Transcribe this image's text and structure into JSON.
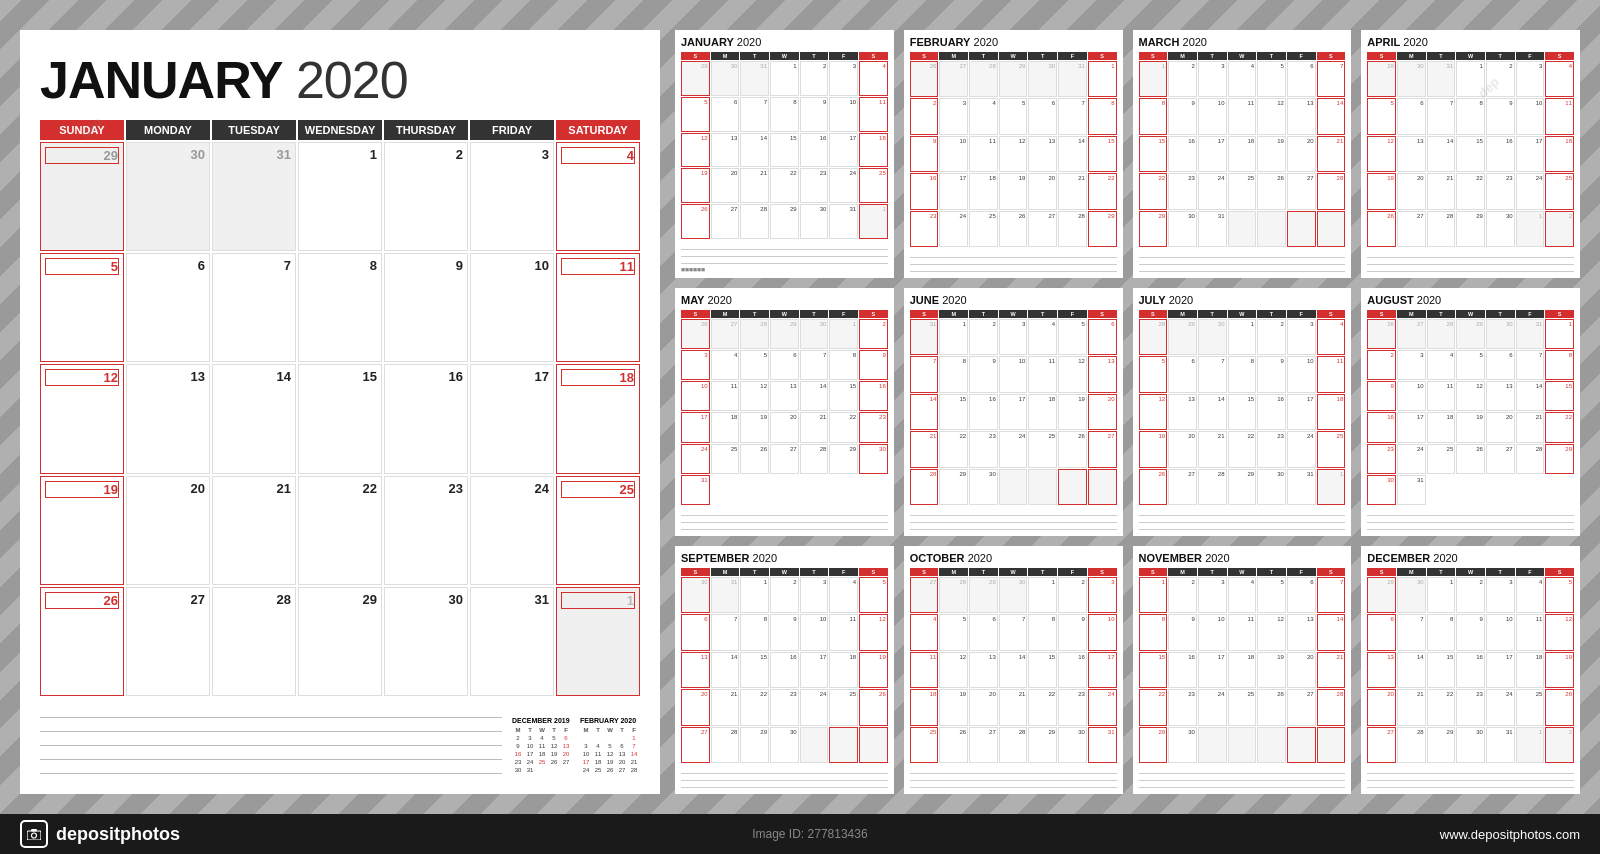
{
  "background": "#a0a0a0",
  "large_calendar": {
    "month": "JANUARY",
    "year": "2020",
    "day_headers": [
      "SUNDAY",
      "MONDAY",
      "TUESDAY",
      "WEDNESDAY",
      "THURSDAY",
      "FRIDAY",
      "SATURDAY"
    ],
    "weeks": [
      [
        {
          "num": "29",
          "other": true,
          "type": "sunday"
        },
        {
          "num": "30",
          "other": true,
          "type": "weekday"
        },
        {
          "num": "31",
          "other": true,
          "type": "weekday"
        },
        {
          "num": "1",
          "other": false,
          "type": "weekday"
        },
        {
          "num": "2",
          "other": false,
          "type": "weekday"
        },
        {
          "num": "3",
          "other": false,
          "type": "weekday"
        },
        {
          "num": "4",
          "other": false,
          "type": "saturday"
        }
      ],
      [
        {
          "num": "5",
          "other": false,
          "type": "sunday"
        },
        {
          "num": "6",
          "other": false,
          "type": "weekday"
        },
        {
          "num": "7",
          "other": false,
          "type": "weekday"
        },
        {
          "num": "8",
          "other": false,
          "type": "weekday"
        },
        {
          "num": "9",
          "other": false,
          "type": "weekday"
        },
        {
          "num": "10",
          "other": false,
          "type": "weekday"
        },
        {
          "num": "11",
          "other": false,
          "type": "saturday"
        }
      ],
      [
        {
          "num": "12",
          "other": false,
          "type": "sunday"
        },
        {
          "num": "13",
          "other": false,
          "type": "weekday"
        },
        {
          "num": "14",
          "other": false,
          "type": "weekday"
        },
        {
          "num": "15",
          "other": false,
          "type": "weekday"
        },
        {
          "num": "16",
          "other": false,
          "type": "weekday"
        },
        {
          "num": "17",
          "other": false,
          "type": "weekday"
        },
        {
          "num": "18",
          "other": false,
          "type": "saturday"
        }
      ],
      [
        {
          "num": "19",
          "other": false,
          "type": "sunday"
        },
        {
          "num": "20",
          "other": false,
          "type": "weekday"
        },
        {
          "num": "21",
          "other": false,
          "type": "weekday"
        },
        {
          "num": "22",
          "other": false,
          "type": "weekday"
        },
        {
          "num": "23",
          "other": false,
          "type": "weekday"
        },
        {
          "num": "24",
          "other": false,
          "type": "weekday"
        },
        {
          "num": "25",
          "other": false,
          "type": "saturday"
        }
      ],
      [
        {
          "num": "26",
          "other": false,
          "type": "sunday"
        },
        {
          "num": "27",
          "other": false,
          "type": "weekday"
        },
        {
          "num": "28",
          "other": false,
          "type": "weekday"
        },
        {
          "num": "29",
          "other": false,
          "type": "weekday"
        },
        {
          "num": "30",
          "other": false,
          "type": "weekday"
        },
        {
          "num": "31",
          "other": false,
          "type": "weekday"
        },
        {
          "num": "1",
          "other": true,
          "type": "saturday"
        }
      ]
    ]
  },
  "months": [
    {
      "name": "JANUARY",
      "year": "2020",
      "id": "jan"
    },
    {
      "name": "FEBRUARY",
      "year": "2020",
      "id": "feb"
    },
    {
      "name": "MARCH",
      "year": "2020",
      "id": "mar"
    },
    {
      "name": "APRIL",
      "year": "2020",
      "id": "apr"
    },
    {
      "name": "MAY",
      "year": "2020",
      "id": "may"
    },
    {
      "name": "JUNE",
      "year": "2020",
      "id": "jun"
    },
    {
      "name": "JULY",
      "year": "2020",
      "id": "jul"
    },
    {
      "name": "AUGUST",
      "year": "2020",
      "id": "aug"
    },
    {
      "name": "SEPTEMBER",
      "year": "2020",
      "id": "sep"
    },
    {
      "name": "OCTOBER",
      "year": "2020",
      "id": "oct"
    },
    {
      "name": "NOVEMBER",
      "year": "2020",
      "id": "nov"
    },
    {
      "name": "DECEMBER",
      "year": "2020",
      "id": "dec"
    }
  ],
  "footer": {
    "brand": "depositphotos",
    "image_id_label": "Image ID:",
    "image_id": "277813436",
    "website": "www.depositphotos.com"
  }
}
